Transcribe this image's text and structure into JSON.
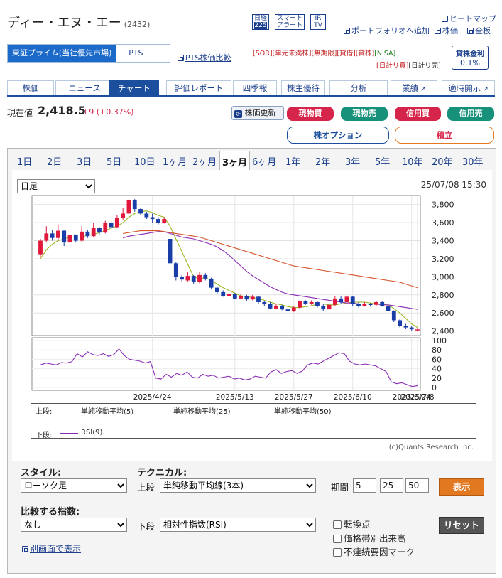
{
  "header": {
    "company": "ディー・エヌ・エー",
    "code": "(2432)",
    "icons": {
      "nikkei": {
        "top": "日経",
        "bottom": "225"
      },
      "smart_alert": {
        "top": "スマート",
        "bottom": "アラート"
      },
      "irtv": {
        "top": "IR",
        "bottom": "TV"
      }
    },
    "links": {
      "heatmap": "ヒートマップ",
      "portfolio": "ポートフォリオへ追加",
      "stock_price": "株価",
      "full_board": "全板",
      "pts_compare": "PTS株価比較"
    }
  },
  "market": {
    "active": "東証プライム(当社優先市場)",
    "pts": "PTS"
  },
  "flags": {
    "row1": [
      "[SOR]",
      "[単元未満株]",
      "[無期限]",
      "[貸借]",
      "[貸株]",
      "[NISA]"
    ],
    "row2": [
      "[日計り買]",
      "[日計り売]"
    ]
  },
  "lending": {
    "label": "貸株金利",
    "value": "0.1%"
  },
  "tabs": [
    "株価",
    "ニュース",
    "チャート",
    "評価レポート",
    "四季報",
    "株主優待",
    "分析",
    "業績",
    "適時開示"
  ],
  "active_tab": "チャート",
  "quote": {
    "label": "現在値",
    "price": "2,418.5",
    "change": "+9 (+0.37%)",
    "refresh": "株価更新"
  },
  "buttons": {
    "cash_buy": "現物買",
    "cash_sell": "現物売",
    "margin_buy": "信用買",
    "margin_sell": "信用売",
    "option": "株オプション",
    "accumulate": "積立"
  },
  "colors": {
    "buy": "#d6254a",
    "sell": "#17917a",
    "brand": "#1b4e9c",
    "show": "#e2781f",
    "reset": "#555555"
  },
  "periods": [
    "1日",
    "2日",
    "3日",
    "5日",
    "10日",
    "1ヶ月",
    "2ヶ月",
    "3ヶ月",
    "6ヶ月",
    "1年",
    "2年",
    "3年",
    "5年",
    "10年",
    "20年",
    "30年"
  ],
  "active_period": "3ヶ月",
  "chart": {
    "interval": "日足",
    "timestamp": "25/07/08 15:30",
    "credit": "(c)Quants Research Inc."
  },
  "legend": {
    "upper_label": "上段:",
    "lower_label": "下段:",
    "upper": [
      "単純移動平均(5)",
      "単純移動平均(25)",
      "単純移動平均(50)"
    ],
    "lower": [
      "RSI(9)"
    ]
  },
  "chart_data": [
    {
      "type": "candlestick",
      "x": [
        "2025/4/24",
        "2025/5/13",
        "2025/5/27",
        "2025/6/10",
        "2025/6/24",
        "2025/7/8"
      ],
      "yticks": [
        3800,
        3600,
        3400,
        3200,
        3000,
        2800,
        2600,
        2400
      ],
      "ylim": [
        2350,
        3900
      ],
      "candles": [
        {
          "o": 3250,
          "c": 3400,
          "h": 3420,
          "l": 3220
        },
        {
          "o": 3400,
          "c": 3480,
          "h": 3560,
          "l": 3380
        },
        {
          "o": 3480,
          "c": 3430,
          "h": 3520,
          "l": 3400
        },
        {
          "o": 3430,
          "c": 3510,
          "h": 3580,
          "l": 3400
        },
        {
          "o": 3510,
          "c": 3380,
          "h": 3520,
          "l": 3340
        },
        {
          "o": 3380,
          "c": 3460,
          "h": 3480,
          "l": 3360
        },
        {
          "o": 3460,
          "c": 3400,
          "h": 3470,
          "l": 3380
        },
        {
          "o": 3400,
          "c": 3500,
          "h": 3560,
          "l": 3390
        },
        {
          "o": 3500,
          "c": 3450,
          "h": 3520,
          "l": 3430
        },
        {
          "o": 3450,
          "c": 3540,
          "h": 3600,
          "l": 3440
        },
        {
          "o": 3540,
          "c": 3490,
          "h": 3550,
          "l": 3470
        },
        {
          "o": 3490,
          "c": 3600,
          "h": 3620,
          "l": 3480
        },
        {
          "o": 3600,
          "c": 3550,
          "h": 3620,
          "l": 3530
        },
        {
          "o": 3550,
          "c": 3650,
          "h": 3680,
          "l": 3540
        },
        {
          "o": 3650,
          "c": 3700,
          "h": 3760,
          "l": 3630
        },
        {
          "o": 3700,
          "c": 3850,
          "h": 3860,
          "l": 3690
        },
        {
          "o": 3850,
          "c": 3750,
          "h": 3860,
          "l": 3720
        },
        {
          "o": 3750,
          "c": 3700,
          "h": 3760,
          "l": 3680
        },
        {
          "o": 3700,
          "c": 3660,
          "h": 3720,
          "l": 3640
        },
        {
          "o": 3660,
          "c": 3640,
          "h": 3700,
          "l": 3600
        },
        {
          "o": 3640,
          "c": 3600,
          "h": 3660,
          "l": 3580
        },
        {
          "o": 3600,
          "c": 3640,
          "h": 3660,
          "l": 3590
        },
        {
          "o": 3420,
          "c": 3150,
          "h": 3430,
          "l": 3120
        },
        {
          "o": 3150,
          "c": 3000,
          "h": 3160,
          "l": 2960
        },
        {
          "o": 3000,
          "c": 2970,
          "h": 3020,
          "l": 2950
        },
        {
          "o": 2960,
          "c": 3010,
          "h": 3050,
          "l": 2950
        },
        {
          "o": 3010,
          "c": 2940,
          "h": 3020,
          "l": 2920
        },
        {
          "o": 2940,
          "c": 3020,
          "h": 3050,
          "l": 2930
        },
        {
          "o": 3020,
          "c": 2980,
          "h": 3040,
          "l": 2960
        },
        {
          "o": 2980,
          "c": 2880,
          "h": 2990,
          "l": 2860
        },
        {
          "o": 2880,
          "c": 2830,
          "h": 2890,
          "l": 2810
        },
        {
          "o": 2830,
          "c": 2790,
          "h": 2850,
          "l": 2780
        },
        {
          "o": 2790,
          "c": 2810,
          "h": 2830,
          "l": 2770
        },
        {
          "o": 2810,
          "c": 2760,
          "h": 2820,
          "l": 2750
        },
        {
          "o": 2760,
          "c": 2790,
          "h": 2810,
          "l": 2750
        },
        {
          "o": 2790,
          "c": 2750,
          "h": 2800,
          "l": 2730
        },
        {
          "o": 2750,
          "c": 2780,
          "h": 2800,
          "l": 2740
        },
        {
          "o": 2780,
          "c": 2720,
          "h": 2790,
          "l": 2700
        },
        {
          "o": 2720,
          "c": 2700,
          "h": 2730,
          "l": 2680
        },
        {
          "o": 2700,
          "c": 2650,
          "h": 2720,
          "l": 2640
        },
        {
          "o": 2650,
          "c": 2680,
          "h": 2700,
          "l": 2640
        },
        {
          "o": 2680,
          "c": 2640,
          "h": 2690,
          "l": 2630
        },
        {
          "o": 2640,
          "c": 2620,
          "h": 2650,
          "l": 2600
        },
        {
          "o": 2620,
          "c": 2660,
          "h": 2680,
          "l": 2610
        },
        {
          "o": 2660,
          "c": 2730,
          "h": 2740,
          "l": 2650
        },
        {
          "o": 2730,
          "c": 2700,
          "h": 2740,
          "l": 2690
        },
        {
          "o": 2700,
          "c": 2720,
          "h": 2740,
          "l": 2690
        },
        {
          "o": 2720,
          "c": 2680,
          "h": 2730,
          "l": 2660
        },
        {
          "o": 2680,
          "c": 2640,
          "h": 2700,
          "l": 2620
        },
        {
          "o": 2640,
          "c": 2690,
          "h": 2700,
          "l": 2630
        },
        {
          "o": 2690,
          "c": 2760,
          "h": 2790,
          "l": 2680
        },
        {
          "o": 2760,
          "c": 2720,
          "h": 2790,
          "l": 2700
        },
        {
          "o": 2720,
          "c": 2780,
          "h": 2800,
          "l": 2710
        },
        {
          "o": 2780,
          "c": 2700,
          "h": 2790,
          "l": 2680
        },
        {
          "o": 2700,
          "c": 2680,
          "h": 2720,
          "l": 2660
        },
        {
          "o": 2680,
          "c": 2700,
          "h": 2720,
          "l": 2670
        },
        {
          "o": 2700,
          "c": 2690,
          "h": 2710,
          "l": 2670
        },
        {
          "o": 2690,
          "c": 2720,
          "h": 2730,
          "l": 2680
        },
        {
          "o": 2720,
          "c": 2680,
          "h": 2730,
          "l": 2670
        },
        {
          "o": 2680,
          "c": 2620,
          "h": 2690,
          "l": 2600
        },
        {
          "o": 2620,
          "c": 2520,
          "h": 2630,
          "l": 2500
        },
        {
          "o": 2520,
          "c": 2460,
          "h": 2530,
          "l": 2440
        },
        {
          "o": 2460,
          "c": 2440,
          "h": 2480,
          "l": 2420
        },
        {
          "o": 2440,
          "c": 2420,
          "h": 2460,
          "l": 2400
        },
        {
          "o": 2410,
          "c": 2418.5,
          "h": 2430,
          "l": 2395
        }
      ],
      "series": [
        {
          "name": "単純移動平均(5)",
          "color": "#9ab622",
          "values": [
            3200,
            3300,
            3360,
            3400,
            3420,
            3440,
            3440,
            3440,
            3460,
            3470,
            3490,
            3510,
            3540,
            3560,
            3600,
            3660,
            3700,
            3720,
            3730,
            3710,
            3680,
            3660,
            3560,
            3420,
            3280,
            3140,
            3000,
            2980,
            2990,
            2960,
            2920,
            2880,
            2850,
            2820,
            2790,
            2780,
            2770,
            2760,
            2740,
            2720,
            2700,
            2690,
            2670,
            2660,
            2660,
            2670,
            2680,
            2700,
            2700,
            2690,
            2690,
            2700,
            2710,
            2720,
            2720,
            2720,
            2710,
            2700,
            2700,
            2690,
            2650,
            2600,
            2540,
            2480,
            2440
          ]
        },
        {
          "name": "単純移動平均(25)",
          "color": "#8a2bb5",
          "values": [
            null,
            null,
            null,
            null,
            null,
            null,
            null,
            null,
            null,
            null,
            null,
            null,
            null,
            null,
            3430,
            3450,
            3460,
            3470,
            3480,
            3490,
            3500,
            3500,
            3480,
            3460,
            3440,
            3430,
            3420,
            3400,
            3380,
            3360,
            3330,
            3290,
            3240,
            3180,
            3120,
            3060,
            3010,
            2970,
            2930,
            2890,
            2860,
            2830,
            2810,
            2800,
            2790,
            2780,
            2770,
            2760,
            2750,
            2740,
            2730,
            2720,
            2710,
            2710,
            2700,
            2700,
            2700,
            2700,
            2690,
            2690,
            2680,
            2670,
            2660,
            2650,
            2640
          ]
        },
        {
          "name": "単純移動平均(50)",
          "color": "#d4552b",
          "values": [
            null,
            null,
            null,
            null,
            null,
            null,
            null,
            null,
            null,
            null,
            null,
            null,
            null,
            null,
            3480,
            3490,
            3500,
            3510,
            3510,
            3510,
            3510,
            3500,
            3490,
            3480,
            3470,
            3460,
            3450,
            3440,
            3420,
            3400,
            3380,
            3360,
            3340,
            3320,
            3300,
            3280,
            3260,
            3240,
            3220,
            3200,
            3180,
            3160,
            3140,
            3120,
            3110,
            3100,
            3090,
            3080,
            3070,
            3060,
            3050,
            3040,
            3030,
            3020,
            3010,
            3000,
            2990,
            2980,
            2970,
            2960,
            2950,
            2940,
            2920,
            2900,
            2880
          ]
        }
      ]
    },
    {
      "type": "line",
      "yticks": [
        100,
        80,
        60,
        40,
        20,
        0
      ],
      "ylim": [
        0,
        100
      ],
      "series": [
        {
          "name": "RSI(9)",
          "color": "#8a2bb5",
          "values": [
            48,
            52,
            50,
            48,
            53,
            52,
            55,
            72,
            65,
            76,
            70,
            68,
            72,
            66,
            70,
            82,
            68,
            60,
            58,
            56,
            52,
            55,
            20,
            18,
            28,
            22,
            30,
            26,
            33,
            22,
            20,
            28,
            24,
            26,
            20,
            22,
            24,
            18,
            20,
            16,
            18,
            24,
            22,
            20,
            33,
            38,
            30,
            34,
            36,
            30,
            35,
            48,
            52,
            50,
            56,
            62,
            68,
            74,
            72,
            56,
            50,
            48,
            50,
            48,
            46,
            40,
            34,
            12,
            8,
            10,
            6,
            2,
            4
          ]
        }
      ]
    }
  ],
  "settings": {
    "style_label": "スタイル:",
    "style_value": "ローソク足",
    "technical_label": "テクニカル:",
    "upper_label": "上段",
    "upper_value": "単純移動平均線(3本)",
    "period_label": "期間",
    "periods": [
      "5",
      "25",
      "50"
    ],
    "show": "表示",
    "compare_label": "比較する指数:",
    "compare_value": "なし",
    "lower_label": "下段",
    "lower_value": "相対性指数(RSI)",
    "reset": "リセット",
    "checkboxes": [
      "転換点",
      "価格帯別出来高",
      "不連続要因マーク"
    ],
    "popout": "別画面で表示"
  }
}
